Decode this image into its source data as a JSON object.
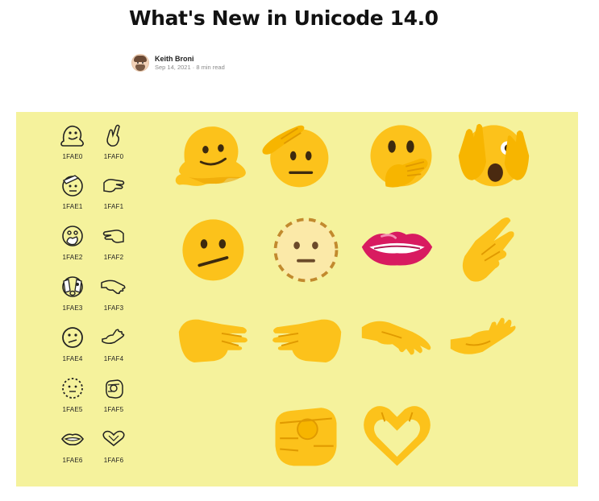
{
  "article": {
    "title": "What's New in Unicode 14.0",
    "author": "Keith Broni",
    "date": "Sep 14, 2021",
    "separator": "·",
    "read_time": "8 min read"
  },
  "codepoints": {
    "faces": [
      "1FAE0",
      "1FAE1",
      "1FAE2",
      "1FAE3",
      "1FAE4",
      "1FAE5",
      "1FAE6"
    ],
    "hands": [
      "1FAF0",
      "1FAF1",
      "1FAF2",
      "1FAF3",
      "1FAF4",
      "1FAF5",
      "1FAF6"
    ]
  },
  "colors": {
    "panel": "#f5f29c",
    "emoji_yellow": "#fcc21b",
    "emoji_shadow": "#e8a000",
    "lips": "#d81b60"
  },
  "emoji_icons": [
    "melting-face",
    "saluting-face",
    "face-with-open-eyes-and-hand-over-mouth",
    "face-with-peeking-eye",
    "face-with-diagonal-mouth",
    "dotted-line-face",
    "biting-lip",
    "hand-with-index-finger-and-thumb-crossed",
    "rightwards-hand",
    "leftwards-hand",
    "palm-down-hand",
    "palm-up-hand",
    "index-pointing-at-the-viewer",
    "heart-hands"
  ]
}
